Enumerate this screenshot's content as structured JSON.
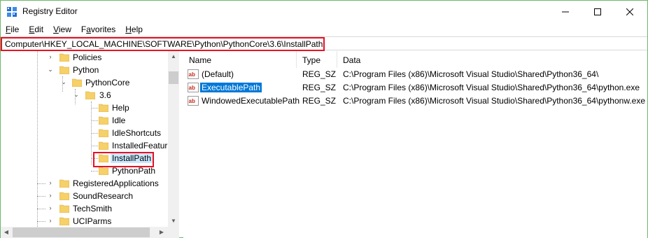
{
  "window": {
    "title": "Registry Editor",
    "controls": {
      "minimize_icon": "minimize-icon",
      "maximize_icon": "maximize-icon",
      "close_icon": "close-icon"
    }
  },
  "menu": [
    {
      "label": "File",
      "u": "F",
      "rest": "ile"
    },
    {
      "label": "Edit",
      "u": "E",
      "rest": "dit"
    },
    {
      "label": "View",
      "u": "V",
      "rest": "iew"
    },
    {
      "label": "Favorites",
      "u": "",
      "pre": "F",
      "mid": "a",
      "post": "vorites"
    },
    {
      "label": "Help",
      "u": "H",
      "rest": "elp"
    }
  ],
  "address": {
    "path": "Computer\\HKEY_LOCAL_MACHINE\\SOFTWARE\\Python\\PythonCore\\3.6\\InstallPath"
  },
  "tree": {
    "items": [
      {
        "label": "Policies"
      },
      {
        "label": "Python",
        "expanded": true
      },
      {
        "label": "PythonCore",
        "expanded": true
      },
      {
        "label": "3.6",
        "expanded": true
      },
      {
        "label": "Help"
      },
      {
        "label": "Idle"
      },
      {
        "label": "IdleShortcuts"
      },
      {
        "label": "InstalledFeatur"
      },
      {
        "label": "InstallPath",
        "selected": true
      },
      {
        "label": "PythonPath"
      },
      {
        "label": "RegisteredApplications"
      },
      {
        "label": "SoundResearch"
      },
      {
        "label": "TechSmith"
      },
      {
        "label": "UCIParms"
      }
    ]
  },
  "list": {
    "headers": {
      "name": "Name",
      "type": "Type",
      "data": "Data"
    },
    "rows": [
      {
        "name": "(Default)",
        "type": "REG_SZ",
        "data": "C:\\Program Files (x86)\\Microsoft Visual Studio\\Shared\\Python36_64\\"
      },
      {
        "name": "ExecutablePath",
        "type": "REG_SZ",
        "data": "C:\\Program Files (x86)\\Microsoft Visual Studio\\Shared\\Python36_64\\python.exe",
        "selected": true
      },
      {
        "name": "WindowedExecutablePath",
        "type": "REG_SZ",
        "data": "C:\\Program Files (x86)\\Microsoft Visual Studio\\Shared\\Python36_64\\pythonw.exe"
      }
    ]
  },
  "colors": {
    "highlight_box": "#e81123",
    "selection": "#0078d7",
    "tree_selection": "#cce8ff",
    "folder": "#f6d068",
    "window_border": "#6cb86c"
  }
}
